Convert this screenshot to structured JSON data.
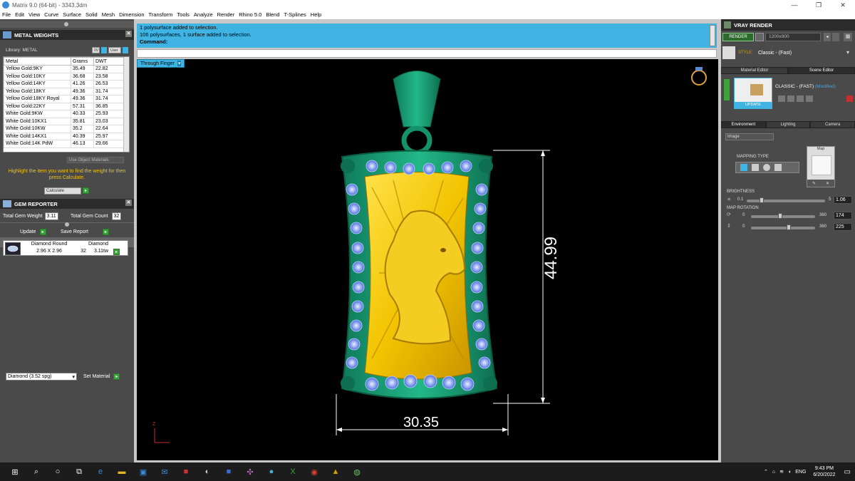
{
  "window": {
    "title": "Matrix 9.0 (64-bit) - 3343.3dm",
    "min": "—",
    "max": "❐",
    "close": "✕"
  },
  "menu": [
    "File",
    "Edit",
    "View",
    "Curve",
    "Surface",
    "Solid",
    "Mesh",
    "Dimension",
    "Transform",
    "Tools",
    "Analyze",
    "Render",
    "Rhino 5.0",
    "Blend",
    "T-Splines",
    "Help"
  ],
  "metal_weights": {
    "title": "METAL WEIGHTS",
    "library_label": "Library: METAL",
    "btn_user": "User",
    "headers": [
      "Metal",
      "Grams",
      "DWT"
    ],
    "rows": [
      [
        "Yellow Gold:9KY",
        "35.49",
        "22.82"
      ],
      [
        "Yellow Gold:10KY",
        "36.68",
        "23.58"
      ],
      [
        "Yellow Gold:14KY",
        "41.26",
        "26.53"
      ],
      [
        "Yellow Gold:18KY",
        "49.36",
        "31.74"
      ],
      [
        "Yellow Gold:18KY Royal",
        "49.36",
        "31.74"
      ],
      [
        "Yellow Gold:22KY",
        "57.31",
        "36.85"
      ],
      [
        "White Gold:9KW",
        "40.33",
        "25.93"
      ],
      [
        "White Gold:10KX1",
        "35.81",
        "23.03"
      ],
      [
        "White Gold:10KW",
        "35.2",
        "22.64"
      ],
      [
        "White Gold:14KX1",
        "40.39",
        "25.97"
      ],
      [
        "White Gold:14K PdW",
        "46.13",
        "29.66"
      ]
    ],
    "use_object_materials": "Use Object Materials",
    "hint": "Highlight the item you want to find the weight for then press Calculate.",
    "calculate": "Calculate"
  },
  "gem_reporter": {
    "title": "GEM REPORTER",
    "total_weight_label": "Total Gem Weight",
    "total_weight": "3.11",
    "total_count_label": "Total Gem Count",
    "total_count": "32",
    "update": "Update",
    "save_report": "Save Report",
    "gem_name": "Diamond Round",
    "gem_type": "Diamond",
    "gem_size": "2.96 X 2.96",
    "gem_count": "32",
    "gem_tw": "3.11tw"
  },
  "material": {
    "select": "Diamond    (3.52 spg)",
    "set_material": "Set Material"
  },
  "command": {
    "lines": [
      "1 polysurface added to selection.",
      "106 polysurfaces, 1 surface added to selection."
    ],
    "prompt": "Command:"
  },
  "viewport": {
    "tab": "Through Finger",
    "dim_height": "44.99",
    "dim_width": "30.35",
    "axis_label": "Z"
  },
  "vray": {
    "title": "VRAY RENDER",
    "render_btn": "RENDER",
    "resolution": "1200x900",
    "style_label": "STYLE:",
    "style_value": "Classic - (Fast)",
    "tabs": [
      "Material Editor",
      "Scene Editor"
    ],
    "preset_name": "CLASSIC - (FAST)",
    "preset_modified": "(Modified)",
    "update": "UPDATE",
    "env_tabs": [
      "Environment",
      "Lighting",
      "Camera"
    ],
    "env_select": "Image",
    "mapping_type": "MAPPING TYPE",
    "map_label": "Map",
    "brightness_label": "BRIGHTNESS",
    "brightness_min": "0.1",
    "brightness_max": "5",
    "brightness_value": "1.06",
    "map_rotation_label": "MAP ROTATION",
    "rot1_min": "0",
    "rot1_max": "360",
    "rot1_value": "174",
    "rot2_min": "0",
    "rot2_max": "360",
    "rot2_value": "225"
  },
  "taskbar": {
    "lang": "ENG",
    "time": "9:43 PM",
    "date": "6/20/2022"
  },
  "colors": {
    "accent_blue": "#3fb4e3",
    "panel": "#4a4a4a",
    "gold": "#f2c400",
    "green_metal": "#1fa57a"
  }
}
